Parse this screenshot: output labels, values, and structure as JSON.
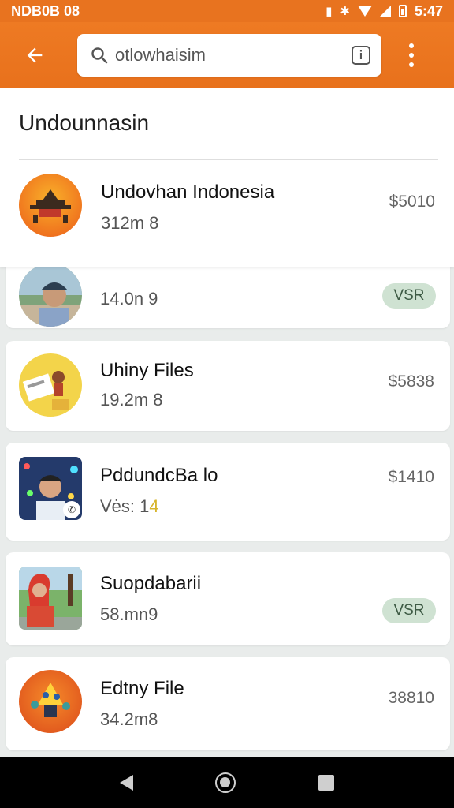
{
  "status_bar": {
    "left_text": "NDB0B 08",
    "time": "5:47",
    "icons": [
      "vibrate-icon",
      "bluetooth-icon",
      "wifi-icon",
      "signal-icon",
      "battery-icon"
    ]
  },
  "app_bar": {
    "back_icon": "arrow-left-icon",
    "search": {
      "value": "otlowhaisim",
      "icon": "search-icon"
    },
    "info_icon": "info-icon",
    "more_icon": "more-vertical-icon"
  },
  "dropdown": {
    "heading": "Undounnasin",
    "suggestion": {
      "title": "Undovhan Indonesia",
      "subtitle": "312m 8",
      "price": "$5010"
    }
  },
  "list": [
    {
      "title": "",
      "subtitle": "14.0n 9",
      "badge": "VSR"
    },
    {
      "title": "Uhiny Files",
      "subtitle": "19.2m 8",
      "price": "$5838"
    },
    {
      "title": "PddundcBa lo",
      "subtitle_main": "Vės: 1",
      "subtitle_accent": "4",
      "price": "$1410"
    },
    {
      "title": "Suopdabarii",
      "subtitle": "58.mn9",
      "badge": "VSR"
    },
    {
      "title": "Edtny File",
      "subtitle": "34.2m8",
      "price": "38810"
    }
  ],
  "nav_bar": {
    "icons": [
      "nav-back-icon",
      "nav-home-icon",
      "nav-recent-apps-icon"
    ]
  },
  "colors": {
    "accent": "#e8731f",
    "badge_bg": "#cfe2d2",
    "badge_text": "#3d5a44",
    "background": "#e9eceb"
  }
}
